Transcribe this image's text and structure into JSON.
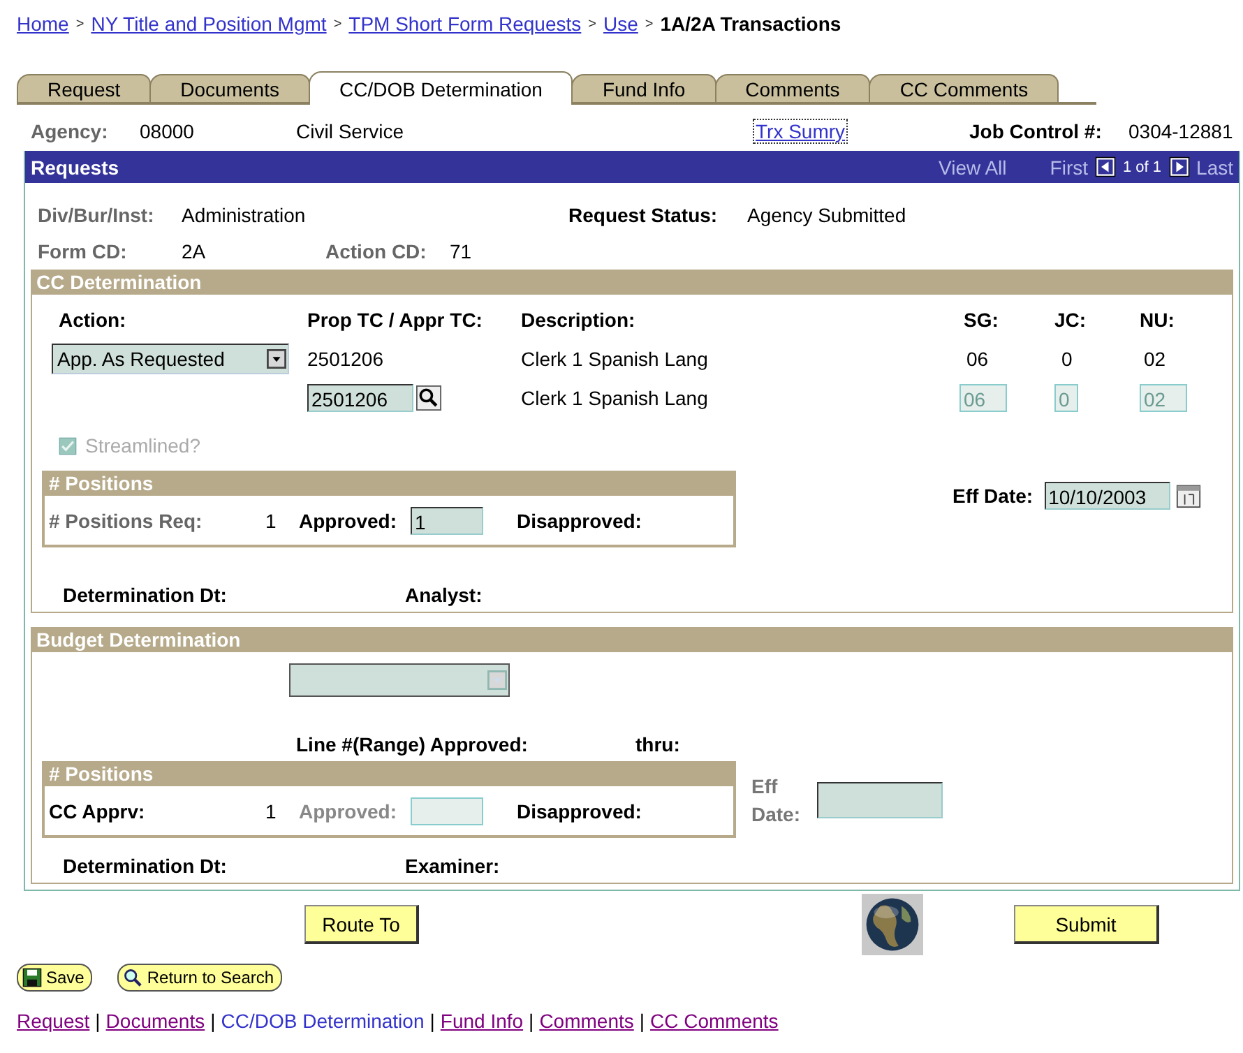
{
  "breadcrumb": [
    {
      "kind": "link",
      "text": "Home"
    },
    {
      "kind": "separator",
      "text": ">"
    },
    {
      "kind": "link",
      "text": "NY Title and Position Mgmt"
    },
    {
      "kind": "separator",
      "text": ">"
    },
    {
      "kind": "link",
      "text": "TPM Short Form Requests"
    },
    {
      "kind": "separator",
      "text": ">"
    },
    {
      "kind": "link",
      "text": "Use"
    },
    {
      "kind": "separator",
      "text": ">"
    },
    {
      "kind": "current",
      "text": "1A/2A Transactions"
    }
  ],
  "tabs": [
    {
      "label": "Request",
      "selected": false
    },
    {
      "label": "Documents",
      "selected": false
    },
    {
      "label": "CC/DOB Determination",
      "selected": true
    },
    {
      "label": "Fund Info",
      "selected": false
    },
    {
      "label": "Comments",
      "selected": false
    },
    {
      "label": "CC Comments",
      "selected": false
    }
  ],
  "header": {
    "agency_label": "Agency:",
    "agency_code": "08000",
    "agency_name": "Civil Service",
    "summary_link": "Trx Sumry",
    "job_control_label": "Job Control #:",
    "job_control": "0304-12881"
  },
  "requests_bar": {
    "title": "Requests",
    "view_all": "View All",
    "first": "First",
    "page": "1 of 1",
    "last": "Last"
  },
  "request_info": {
    "div_label": "Div/Bur/Inst:",
    "div_value": "Administration",
    "status_label": "Request Status:",
    "status_value": "Agency Submitted",
    "form_label": "Form CD:",
    "form_value": "2A",
    "action_cd_label": "Action CD:",
    "action_cd_value": "71"
  },
  "cc_determination": {
    "title": "CC Determination",
    "columns": [
      "Action:",
      "Prop TC / Appr TC:",
      "Description:",
      "SG:",
      "JC:",
      "NU:"
    ],
    "action_select": {
      "value": "App. As Requested",
      "disabled": false
    },
    "proposed": {
      "tc": "2501206",
      "description": "Clerk 1 Spanish Lang",
      "sg": "06",
      "jc": "0",
      "nu": "02"
    },
    "approved": {
      "tc": {
        "value": "2501206",
        "disabled": false
      },
      "description": "Clerk 1 Spanish Lang",
      "sg": {
        "value": "06",
        "disabled": true
      },
      "jc": {
        "value": "0",
        "disabled": true
      },
      "nu": {
        "value": "02",
        "disabled": true
      }
    },
    "streamlined": {
      "label": "Streamlined?",
      "checked": true,
      "disabled": true
    },
    "positions": {
      "title": "# Positions",
      "count_label": "# Positions Req:",
      "count": "1",
      "approved_label": "Approved:",
      "approved": {
        "value": "1",
        "disabled": false
      },
      "disapproved_label": "Disapproved:"
    },
    "eff_date": {
      "label": "Eff Date:",
      "value": "10/10/2003",
      "disabled": false
    },
    "determination_label": "Determination Dt:",
    "person_label": "Analyst:"
  },
  "budget_determination": {
    "title": "Budget Determination",
    "select": {
      "disabled": true
    },
    "line_label": "Line #(Range) Approved:",
    "thru_label": "thru:",
    "positions": {
      "title": "# Positions",
      "count_label": "CC Apprv:",
      "count": "1",
      "approved_label": "Approved:",
      "approved": {
        "disabled": true
      },
      "disapproved_label": "Disapproved:"
    },
    "eff_date": {
      "label": "Eff Date:",
      "disabled": false
    },
    "determination_label": "Determination Dt:",
    "person_label": "Examiner:"
  },
  "buttons": {
    "route": "Route To",
    "submit": "Submit",
    "save": "Save",
    "return": "Return to Search"
  },
  "footer_links": [
    {
      "kind": "link",
      "text": "Request",
      "selected": false
    },
    {
      "kind": "separator",
      "text": "|"
    },
    {
      "kind": "link",
      "text": "Documents",
      "selected": false
    },
    {
      "kind": "separator",
      "text": "|"
    },
    {
      "kind": "link",
      "text": "CC/DOB Determination",
      "selected": true
    },
    {
      "kind": "separator",
      "text": "|"
    },
    {
      "kind": "link",
      "text": "Fund Info",
      "selected": false
    },
    {
      "kind": "separator",
      "text": "|"
    },
    {
      "kind": "link",
      "text": "Comments",
      "selected": false
    },
    {
      "kind": "separator",
      "text": "|"
    },
    {
      "kind": "link",
      "text": "CC Comments",
      "selected": false
    }
  ]
}
